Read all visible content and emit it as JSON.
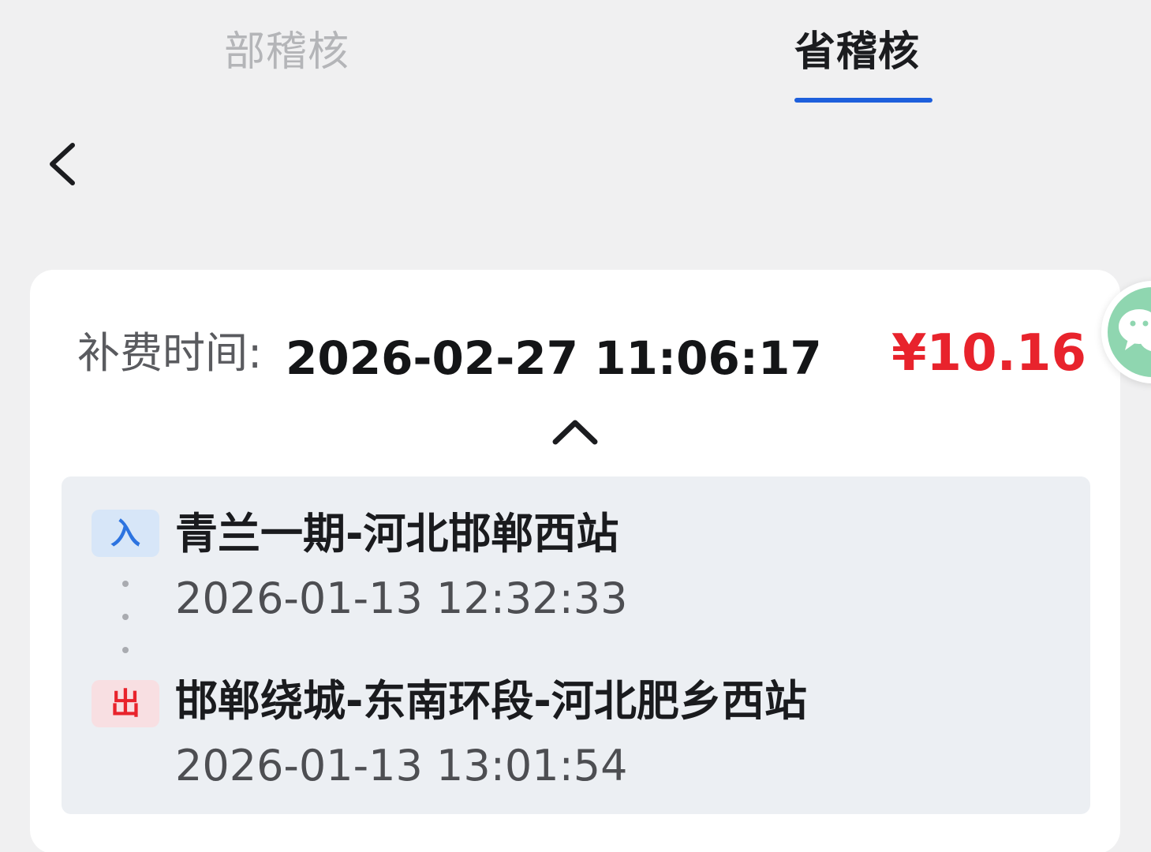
{
  "tabs": [
    {
      "label": "部稽核",
      "active": false
    },
    {
      "label": "省稽核",
      "active": true
    }
  ],
  "icons": {
    "back": "chevron-left-icon",
    "collapse": "chevron-up-icon",
    "float": "wechat-icon"
  },
  "record": {
    "fee_label": "补费时间:",
    "fee_time": "2026-02-27 11:06:17",
    "amount": "¥10.16",
    "entry": {
      "badge": "入",
      "station": "青兰一期-河北邯郸西站",
      "time": "2026-01-13 12:32:33"
    },
    "exit": {
      "badge": "出",
      "station": "邯郸绕城-东南环段-河北肥乡西站",
      "time": "2026-01-13 13:01:54"
    }
  },
  "colors": {
    "accent": "#1d5fdc",
    "amount": "#e8232c",
    "entry_badge": "#2c73e0",
    "exit_badge": "#e8232c"
  }
}
